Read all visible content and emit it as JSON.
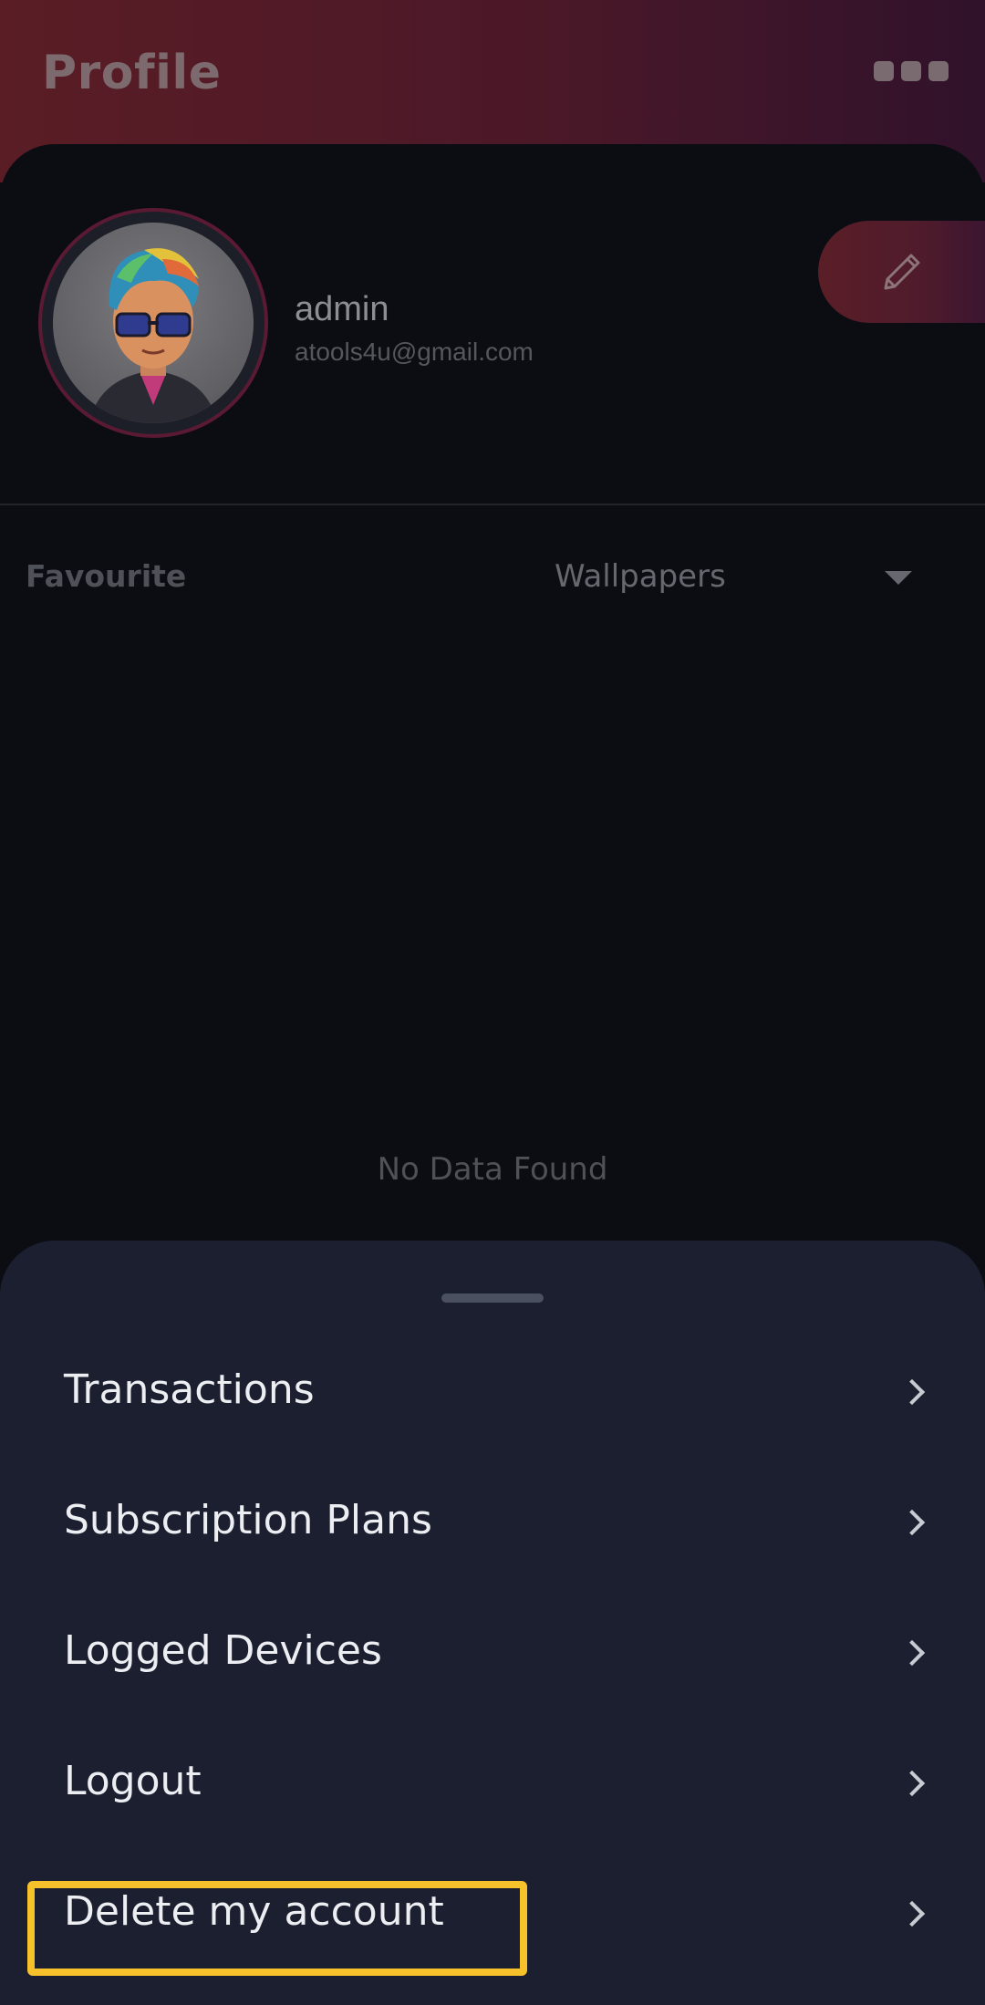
{
  "header": {
    "title": "Profile",
    "more_icon": "more-horizontal-icon",
    "gradient": [
      "#5a1d25",
      "#30122b"
    ]
  },
  "profile": {
    "name": "admin",
    "email": "atools4u@gmail.com",
    "avatar_icon": "avatar-cartoon",
    "edit_icon": "pencil-icon"
  },
  "favourites": {
    "label": "Favourite",
    "filter_value": "Wallpapers",
    "filter_icon": "caret-down-icon",
    "empty_text": "No Data Found"
  },
  "menu": {
    "items": [
      {
        "label": "Transactions",
        "icon": "chevron-right-icon"
      },
      {
        "label": "Subscription Plans",
        "icon": "chevron-right-icon"
      },
      {
        "label": "Logged Devices",
        "icon": "chevron-right-icon"
      },
      {
        "label": "Logout",
        "icon": "chevron-right-icon"
      },
      {
        "label": "Delete my account",
        "icon": "chevron-right-icon"
      }
    ]
  },
  "colors": {
    "sheet_bg": "#1b1f30",
    "highlight": "#f6c12a"
  }
}
